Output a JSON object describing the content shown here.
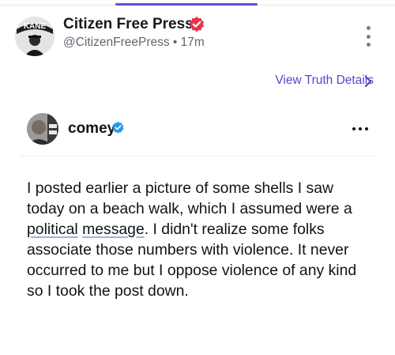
{
  "header": {
    "avatar_badge_text": "KANE",
    "author_name": "Citizen Free Press",
    "handle": "@CitizenFreePress",
    "separator": "•",
    "time_ago": "17m"
  },
  "actions": {
    "view_details_label": "View Truth Details"
  },
  "embedded_post": {
    "author_name": "comey",
    "body_before": "I posted earlier a picture of some shells I saw today on a beach walk, which I assumed were a ",
    "underlined_1": "political",
    "between": " ",
    "underlined_2": "message",
    "body_after": ". I didn't realize some folks associate those numbers with violence. It never occurred to me but I oppose violence of any kind so I took the post down."
  },
  "colors": {
    "accent": "#5c4fd6",
    "link": "#5448c8",
    "verified_red": "#e8334a",
    "verified_blue": "#1d9bf0"
  }
}
